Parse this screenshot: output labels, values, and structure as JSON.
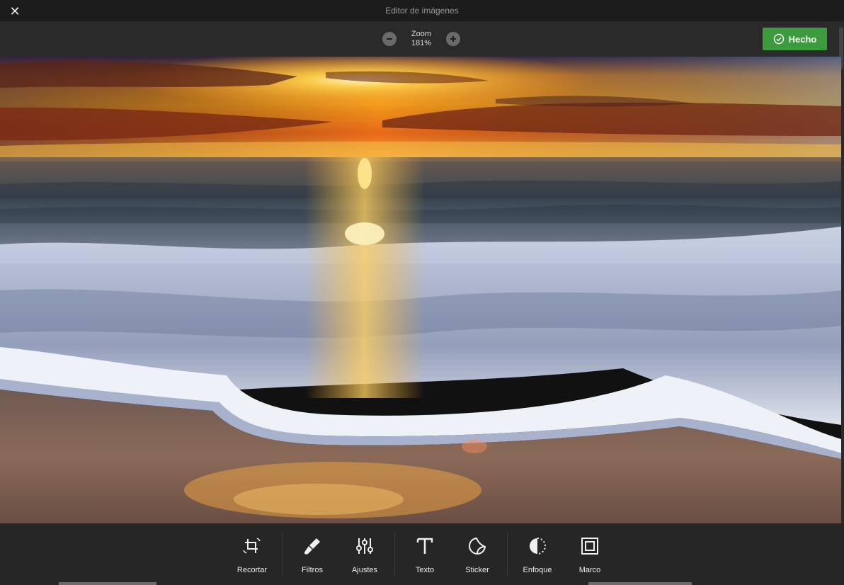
{
  "window": {
    "title": "Editor de imágenes",
    "close_icon": "close-icon"
  },
  "zoom": {
    "label": "Zoom",
    "value": "181%"
  },
  "done_button": {
    "label": "Hecho",
    "color": "#3d9a3d"
  },
  "tools": [
    {
      "label": "Recortar",
      "icon": "crop-icon"
    },
    {
      "label": "Filtros",
      "icon": "brush-icon"
    },
    {
      "label": "Ajustes",
      "icon": "sliders-icon"
    },
    {
      "label": "Texto",
      "icon": "text-icon"
    },
    {
      "label": "Sticker",
      "icon": "sticker-icon"
    },
    {
      "label": "Enfoque",
      "icon": "focus-icon"
    },
    {
      "label": "Marco",
      "icon": "frame-icon"
    }
  ]
}
